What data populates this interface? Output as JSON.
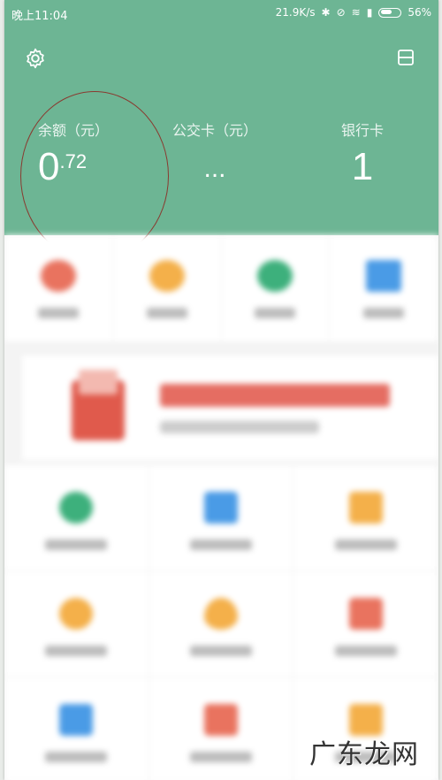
{
  "status_bar": {
    "time": "晚上11:04",
    "speed": "21.9K/s",
    "battery_pct": "56%"
  },
  "header": {
    "settings_icon": "gear-icon",
    "card_icon": "card-icon",
    "colors": {
      "primary": "#6db594",
      "annotation": "#8a3a30"
    }
  },
  "stats": [
    {
      "label": "余额（元）",
      "value_int": "0",
      "value_dec": ".72"
    },
    {
      "label": "公交卡（元）",
      "value": "..."
    },
    {
      "label": "银行卡",
      "value": "1"
    }
  ],
  "quick_actions": [
    {
      "icon": "red-circle-icon",
      "color": "#e9735f"
    },
    {
      "icon": "orange-circle-icon",
      "color": "#f4b04a"
    },
    {
      "icon": "green-circle-icon",
      "color": "#3db07c"
    },
    {
      "icon": "blue-card-icon",
      "color": "#4a9be6"
    }
  ],
  "grid": [
    {
      "icon": "phone-icon",
      "color": "#3db07c"
    },
    {
      "icon": "blue-square-icon",
      "color": "#4a9be6"
    },
    {
      "icon": "orange-square-icon",
      "color": "#f4b04a"
    },
    {
      "icon": "orange-circle-icon",
      "color": "#f4b04a"
    },
    {
      "icon": "drop-icon",
      "color": "#f4b04a"
    },
    {
      "icon": "red-square-icon",
      "color": "#e9735f"
    },
    {
      "icon": "blue-square-icon",
      "color": "#4a9be6"
    },
    {
      "icon": "red-square-icon",
      "color": "#e9735f"
    },
    {
      "icon": "orange-square-icon",
      "color": "#f4b04a"
    }
  ],
  "watermark": {
    "text": "广东龙网"
  }
}
